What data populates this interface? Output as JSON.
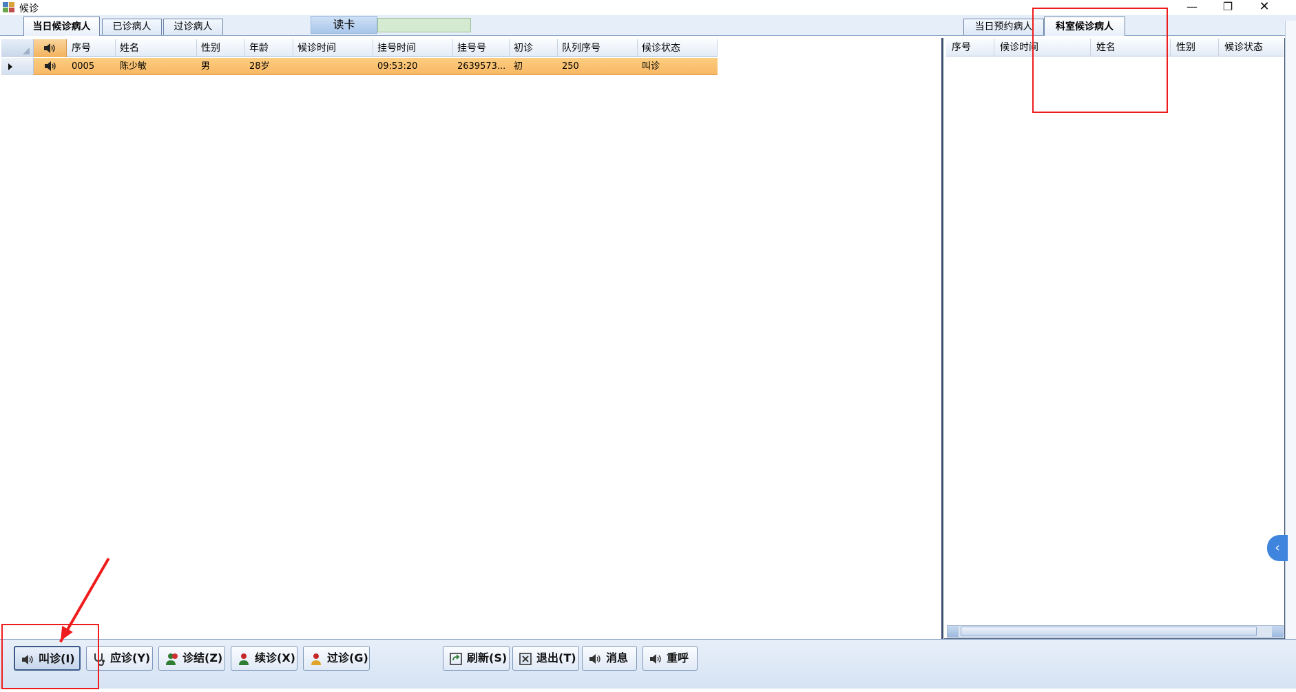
{
  "window": {
    "title": "候诊",
    "controls": [
      "—",
      "❐",
      "✕"
    ]
  },
  "left_tabs": [
    {
      "label": "当日候诊病人",
      "active": true
    },
    {
      "label": "已诊病人",
      "active": false
    },
    {
      "label": "过诊病人",
      "active": false
    }
  ],
  "read_card": {
    "label": "读卡",
    "value": ""
  },
  "right_tabs": [
    {
      "label": "当日预约病人",
      "active": false
    },
    {
      "label": "科室候诊病人",
      "active": true
    }
  ],
  "left_grid": {
    "columns": [
      "序号",
      "姓名",
      "性别",
      "年龄",
      "候诊时间",
      "挂号时间",
      "挂号号",
      "初诊",
      "队列序号",
      "候诊状态"
    ],
    "rows": [
      {
        "seq": "0005",
        "name": "陈少敏",
        "gender": "男",
        "age": "28岁",
        "wait_time": "",
        "reg_time": "09:53:20",
        "reg_no": "2639573...",
        "first_visit": "初",
        "queue_no": "250",
        "status": "叫诊"
      }
    ]
  },
  "right_grid": {
    "columns": [
      "序号",
      "候诊时间",
      "姓名",
      "性别",
      "候诊状态"
    ],
    "rows": []
  },
  "toolbar": {
    "call": "叫诊(I)",
    "respond": "应诊(Y)",
    "finish": "诊结(Z)",
    "continue": "续诊(X)",
    "skip": "过诊(G)",
    "refresh": "刷新(S)",
    "exit": "退出(T)",
    "message": "消息",
    "recall": "重呼"
  },
  "side_collapse": "‹",
  "colors": {
    "selected_row": "#f8b865",
    "tab_strip": "#e5eef9",
    "annotation": "#ee1c1c",
    "card_input": "#d5ebd1"
  }
}
